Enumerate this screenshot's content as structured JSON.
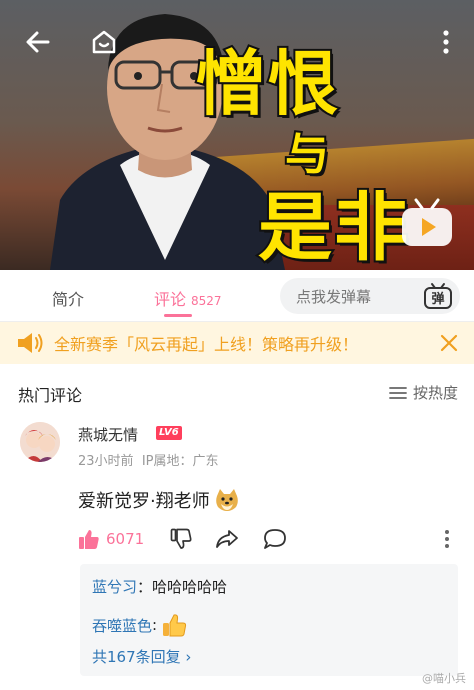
{
  "video": {
    "overlay_title_line1": "憎恨",
    "overlay_title_line2": "与",
    "overlay_title_line3": "是非",
    "icons": [
      "back-arrow-icon",
      "home-face-icon",
      "more-vertical-icon",
      "tv-play-icon"
    ]
  },
  "tabs": {
    "intro_label": "简介",
    "comments_label": "评论",
    "comments_count": "8527",
    "danmaku_placeholder": "点我发弹幕",
    "danmaku_toggle_label": "弹"
  },
  "notice": {
    "text": "全新赛季「风云再起」上线！策略再升级！",
    "color": "#f0a020"
  },
  "hot": {
    "title": "热门评论",
    "sort_label": "按热度"
  },
  "comment": {
    "username": "燕城无情",
    "level": "LV6",
    "time": "23小时前",
    "ip_location": "IP属地：广东",
    "text": "爱新觉罗·翔老师",
    "like_count": "6071",
    "replies": [
      {
        "name": "蓝兮习",
        "sep": "：",
        "text": "哈哈哈哈哈"
      },
      {
        "name": "吞噬蓝色",
        "sep": ":",
        "text": ""
      }
    ],
    "more_replies": "共167条回复 ›"
  },
  "watermark": "@喵小兵",
  "colors": {
    "accent": "#fb7299",
    "link": "#2f76b5"
  }
}
